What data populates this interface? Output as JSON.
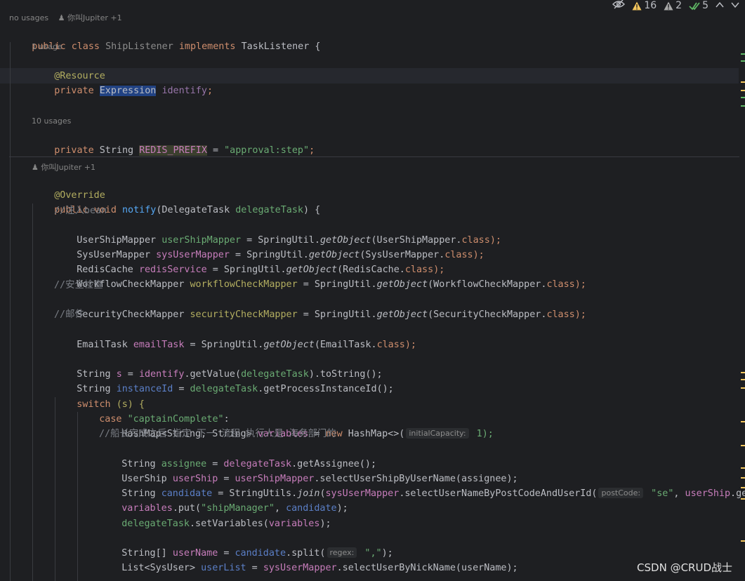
{
  "toolbar": {
    "reader_mode_icon": "eye-slash-icon",
    "warnings_count": "16",
    "weak_warnings_count": "2",
    "ok_count": "5",
    "colors": {
      "warning": "#f2c55c",
      "weak_warning": "#a8a8a8",
      "ok": "#5fb865"
    }
  },
  "hints": {
    "class_usages": "no usages",
    "class_author": "你叫Jupiter +1",
    "field1_usages": "1 usage",
    "field2_usages": "10 usages",
    "method_author": "你叫Jupiter +1"
  },
  "code": {
    "l_class": [
      "public ",
      "class ",
      "ShipListener",
      " implements ",
      "TaskListener",
      " {"
    ],
    "l_resource": "@Resource",
    "l_field1": [
      "private ",
      "Expression",
      " ",
      "identify",
      ";"
    ],
    "l_field2": [
      "private ",
      "String ",
      "REDIS_PREFIX",
      " = ",
      "\"approval:step\"",
      ";"
    ],
    "l_override": "@Override",
    "l_method": [
      "public ",
      "void ",
      "notify",
      "(DelegateTask ",
      "delegateTask",
      ") {"
    ],
    "c_inject": "//注入bean",
    "l_ship": [
      "UserShipMapper ",
      "userShipMapper",
      " = SpringUtil.",
      "getObject",
      "(UserShipMapper.",
      "class",
      ");"
    ],
    "l_sysuser": [
      "SysUserMapper ",
      "sysUserMapper",
      " = SpringUtil.",
      "getObject",
      "(SysUserMapper.",
      "class",
      ");"
    ],
    "l_redis": [
      "RedisCache ",
      "redisService",
      " = SpringUtil.",
      "getObject",
      "(RedisCache.",
      "class",
      ");"
    ],
    "l_workflow": [
      "WorkflowCheckMapper ",
      "workflowCheckMapper",
      " = SpringUtil.",
      "getObject",
      "(WorkflowCheckMapper.",
      "class",
      ");"
    ],
    "c_security": "//安全检查",
    "l_security": [
      "SecurityCheckMapper ",
      "securityCheckMapper",
      " = SpringUtil.",
      "getObject",
      "(SecurityCheckMapper.",
      "class",
      ");"
    ],
    "c_mail": "//邮件",
    "l_email": [
      "EmailTask ",
      "emailTask",
      " = SpringUtil.",
      "getObject",
      "(EmailTask.",
      "class",
      ");"
    ],
    "l_s": [
      "String ",
      "s",
      " = ",
      "identify",
      ".getValue(",
      "delegateTask",
      ").toString();"
    ],
    "l_instance": [
      "String ",
      "instanceId",
      " = ",
      "delegateTask",
      ".getProcessInstanceId();"
    ],
    "l_switch": [
      "switch ",
      "(s) {"
    ],
    "l_case": [
      "case ",
      "\"captainComplete\"",
      ":"
    ],
    "l_hashmap": [
      "HashMap<String, String> ",
      "variables",
      " = ",
      "new ",
      "HashMap<>(",
      "initialCapacity:",
      " 1);"
    ],
    "c_captain": "//船长完成之后 指定 下一 流程 执行人是 海务部门的",
    "l_assignee": [
      "String ",
      "assignee",
      " = ",
      "delegateTask",
      ".getAssignee();"
    ],
    "l_usership": [
      "UserShip ",
      "userShip",
      " = ",
      "userShipMapper",
      ".selectUserShipByUserName(assignee);"
    ],
    "l_candidate": [
      "String ",
      "candidate",
      " = StringUtils.",
      "join",
      "(",
      "sysUserMapper",
      ".selectUserNameByPostCodeAndUserId(",
      "postCode:",
      " ",
      "\"se\"",
      ", ",
      "userShip",
      ".getUserS"
    ],
    "l_put": [
      "variables",
      ".put(",
      "\"shipManager\"",
      ", ",
      "candidate",
      ");"
    ],
    "l_setvars": [
      "delegateTask",
      ".setVariables(",
      "variables",
      ");"
    ],
    "l_split": [
      "String[] ",
      "userName",
      " = ",
      "candidate",
      ".split(",
      "regex:",
      " ",
      "\",\"",
      ");"
    ],
    "l_list": [
      "List<SysUser> ",
      "userList",
      " = ",
      "sysUserMapper",
      ".selectUserByNickName(userName);"
    ]
  },
  "watermark": "CSDN @CRUD战士"
}
